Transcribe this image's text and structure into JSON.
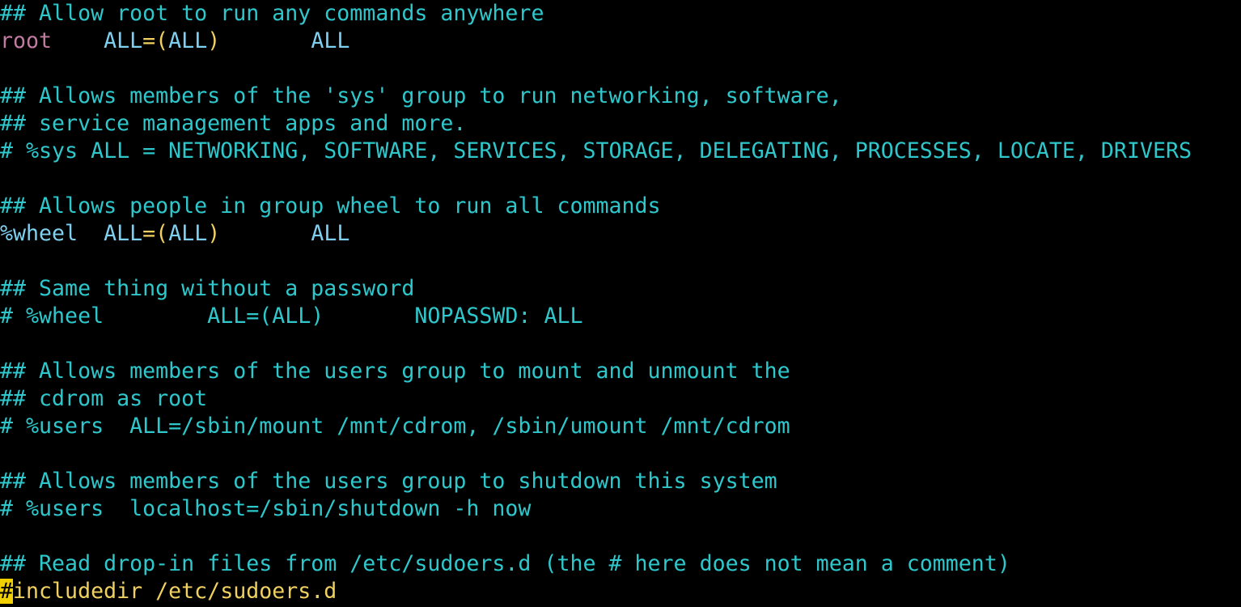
{
  "lines": [
    {
      "segments": [
        {
          "text": "## Allow root to run any commands anywhere",
          "cls": "c"
        }
      ]
    },
    {
      "segments": [
        {
          "text": "root",
          "cls": "p"
        },
        {
          "text": "    ",
          "cls": "c"
        },
        {
          "text": "ALL",
          "cls": "b"
        },
        {
          "text": "=",
          "cls": "y"
        },
        {
          "text": "(",
          "cls": "y"
        },
        {
          "text": "ALL",
          "cls": "b"
        },
        {
          "text": ")",
          "cls": "y"
        },
        {
          "text": "       ",
          "cls": "c"
        },
        {
          "text": "ALL",
          "cls": "b"
        }
      ]
    },
    {
      "segments": []
    },
    {
      "segments": [
        {
          "text": "## Allows members of the 'sys' group to run networking, software,",
          "cls": "c"
        }
      ]
    },
    {
      "segments": [
        {
          "text": "## service management apps and more.",
          "cls": "c"
        }
      ]
    },
    {
      "segments": [
        {
          "text": "# %sys ALL = NETWORKING, SOFTWARE, SERVICES, STORAGE, DELEGATING, PROCESSES, LOCATE, DRIVERS",
          "cls": "c"
        }
      ]
    },
    {
      "segments": []
    },
    {
      "segments": [
        {
          "text": "## Allows people in group wheel to run all commands",
          "cls": "c"
        }
      ]
    },
    {
      "segments": [
        {
          "text": "%wheel",
          "cls": "b"
        },
        {
          "text": "  ",
          "cls": "c"
        },
        {
          "text": "ALL",
          "cls": "b"
        },
        {
          "text": "=",
          "cls": "y"
        },
        {
          "text": "(",
          "cls": "y"
        },
        {
          "text": "ALL",
          "cls": "b"
        },
        {
          "text": ")",
          "cls": "y"
        },
        {
          "text": "       ",
          "cls": "c"
        },
        {
          "text": "ALL",
          "cls": "b"
        }
      ]
    },
    {
      "segments": []
    },
    {
      "segments": [
        {
          "text": "## Same thing without a password",
          "cls": "c"
        }
      ]
    },
    {
      "segments": [
        {
          "text": "# %wheel        ALL=(ALL)       NOPASSWD: ALL",
          "cls": "c"
        }
      ]
    },
    {
      "segments": []
    },
    {
      "segments": [
        {
          "text": "## Allows members of the users group to mount and unmount the",
          "cls": "c"
        }
      ]
    },
    {
      "segments": [
        {
          "text": "## cdrom as root",
          "cls": "c"
        }
      ]
    },
    {
      "segments": [
        {
          "text": "# %users  ALL=/sbin/mount /mnt/cdrom, /sbin/umount /mnt/cdrom",
          "cls": "c"
        }
      ]
    },
    {
      "segments": []
    },
    {
      "segments": [
        {
          "text": "## Allows members of the users group to shutdown this system",
          "cls": "c"
        }
      ]
    },
    {
      "segments": [
        {
          "text": "# %users  localhost=/sbin/shutdown -h now",
          "cls": "c"
        }
      ]
    },
    {
      "segments": []
    },
    {
      "segments": [
        {
          "text": "## Read drop-in files from /etc/sudoers.d (the # here does not mean a comment)",
          "cls": "c"
        }
      ]
    },
    {
      "segments": [
        {
          "text": "#",
          "cls": "cursor"
        },
        {
          "text": "includedir /etc/sudoers.d",
          "cls": "y"
        }
      ]
    }
  ],
  "colors": {
    "background": "#000000",
    "comment": "#2ec8cc",
    "user": "#c27ba0",
    "keyword": "#7fd0f0",
    "preproc": "#f0d060",
    "cursor": "#f0d000"
  }
}
